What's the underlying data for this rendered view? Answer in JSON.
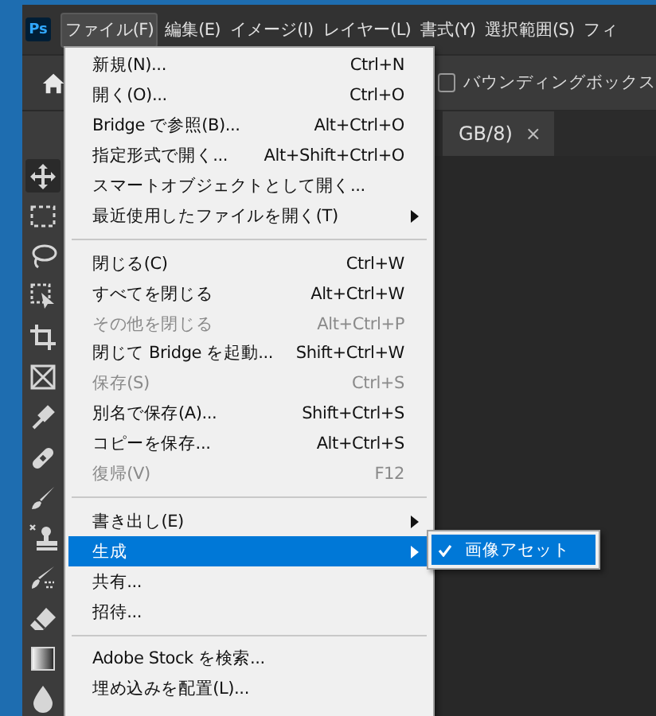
{
  "app": {
    "logo": "Ps"
  },
  "menubar": [
    {
      "label": "ファイル(F)",
      "selected": true
    },
    {
      "label": "編集(E)",
      "selected": false
    },
    {
      "label": "イメージ(I)",
      "selected": false
    },
    {
      "label": "レイヤー(L)",
      "selected": false
    },
    {
      "label": "書式(Y)",
      "selected": false
    },
    {
      "label": "選択範囲(S)",
      "selected": false
    },
    {
      "label": "フィ",
      "selected": false
    }
  ],
  "options_bar": {
    "checkbox": {
      "label": "バウンディングボックス",
      "checked": false
    }
  },
  "document_tab": {
    "title": "GB/8)",
    "close": "×"
  },
  "file_menu": {
    "items": [
      {
        "kind": "item",
        "label": "新規(N)...",
        "shortcut": "Ctrl+N",
        "disabled": false,
        "submenu": false,
        "selected": false
      },
      {
        "kind": "item",
        "label": "開く(O)...",
        "shortcut": "Ctrl+O",
        "disabled": false,
        "submenu": false,
        "selected": false
      },
      {
        "kind": "item",
        "label": "Bridge で参照(B)...",
        "shortcut": "Alt+Ctrl+O",
        "disabled": false,
        "submenu": false,
        "selected": false
      },
      {
        "kind": "item",
        "label": "指定形式で開く...",
        "shortcut": "Alt+Shift+Ctrl+O",
        "disabled": false,
        "submenu": false,
        "selected": false
      },
      {
        "kind": "item",
        "label": "スマートオブジェクトとして開く...",
        "disabled": false,
        "submenu": false,
        "selected": false
      },
      {
        "kind": "item",
        "label": "最近使用したファイルを開く(T)",
        "disabled": false,
        "submenu": true,
        "selected": false
      },
      {
        "kind": "separator"
      },
      {
        "kind": "item",
        "label": "閉じる(C)",
        "shortcut": "Ctrl+W",
        "disabled": false,
        "submenu": false,
        "selected": false
      },
      {
        "kind": "item",
        "label": "すべてを閉じる",
        "shortcut": "Alt+Ctrl+W",
        "disabled": false,
        "submenu": false,
        "selected": false
      },
      {
        "kind": "item",
        "label": "その他を閉じる",
        "shortcut": "Alt+Ctrl+P",
        "disabled": true,
        "submenu": false,
        "selected": false
      },
      {
        "kind": "item",
        "label": "閉じて Bridge を起動...",
        "shortcut": "Shift+Ctrl+W",
        "disabled": false,
        "submenu": false,
        "selected": false
      },
      {
        "kind": "item",
        "label": "保存(S)",
        "shortcut": "Ctrl+S",
        "disabled": true,
        "submenu": false,
        "selected": false
      },
      {
        "kind": "item",
        "label": "別名で保存(A)...",
        "shortcut": "Shift+Ctrl+S",
        "disabled": false,
        "submenu": false,
        "selected": false
      },
      {
        "kind": "item",
        "label": "コピーを保存...",
        "shortcut": "Alt+Ctrl+S",
        "disabled": false,
        "submenu": false,
        "selected": false
      },
      {
        "kind": "item",
        "label": "復帰(V)",
        "shortcut": "F12",
        "disabled": true,
        "submenu": false,
        "selected": false
      },
      {
        "kind": "separator"
      },
      {
        "kind": "item",
        "label": "書き出し(E)",
        "disabled": false,
        "submenu": true,
        "selected": false
      },
      {
        "kind": "item",
        "label": "生成",
        "disabled": false,
        "submenu": true,
        "selected": true
      },
      {
        "kind": "item",
        "label": "共有...",
        "disabled": false,
        "submenu": false,
        "selected": false
      },
      {
        "kind": "item",
        "label": "招待...",
        "disabled": false,
        "submenu": false,
        "selected": false
      },
      {
        "kind": "separator"
      },
      {
        "kind": "item",
        "label": "Adobe Stock を検索...",
        "disabled": false,
        "submenu": false,
        "selected": false
      },
      {
        "kind": "item",
        "label": "埋め込みを配置(L)...",
        "disabled": false,
        "submenu": false,
        "selected": false
      }
    ]
  },
  "submenu": {
    "items": [
      {
        "label": "画像アセット",
        "checked": true,
        "selected": true
      }
    ]
  }
}
